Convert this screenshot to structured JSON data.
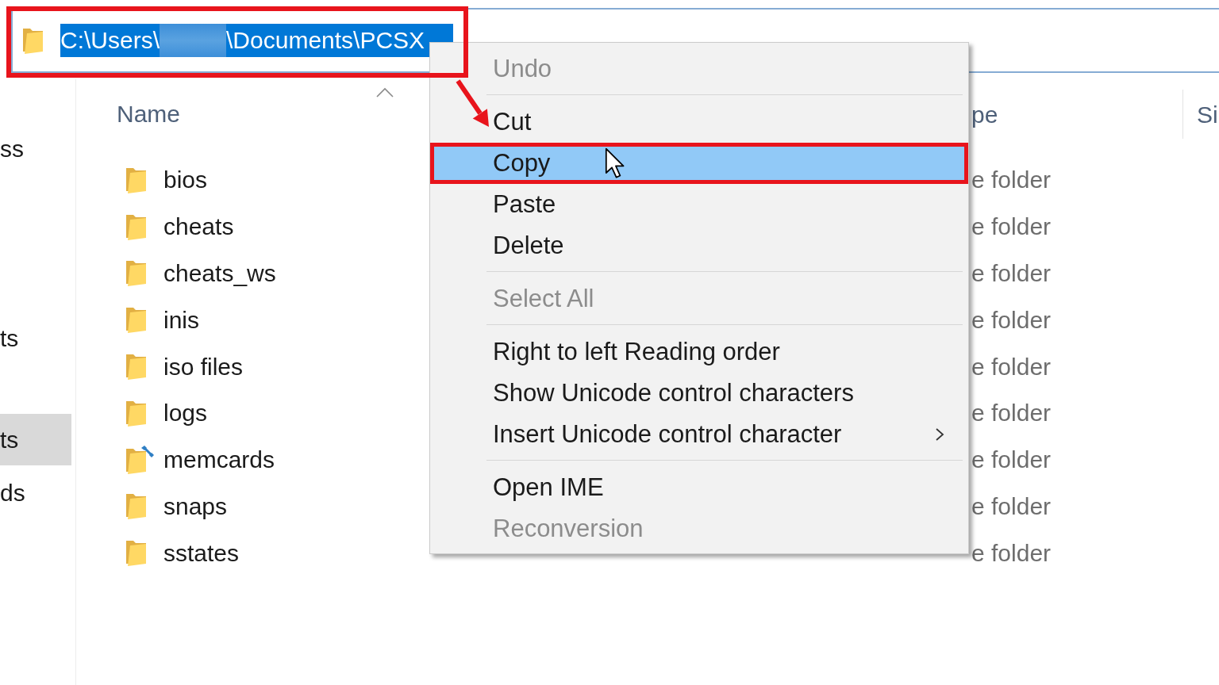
{
  "address_bar": {
    "selected": true,
    "segments": [
      {
        "kind": "text",
        "text": "C:\\Users\\"
      },
      {
        "kind": "redacted"
      },
      {
        "kind": "text",
        "text": "\\Documents\\PCSX"
      }
    ]
  },
  "navigation_pane": {
    "items": [
      {
        "label": "ss",
        "selected": false
      },
      {
        "label": "ts",
        "selected": false
      },
      {
        "label": "ts",
        "selected": true
      },
      {
        "label": "ds",
        "selected": false
      }
    ]
  },
  "file_list": {
    "columns": [
      {
        "label": "Name",
        "sorted": true
      },
      {
        "label": "pe",
        "sorted": false
      },
      {
        "label": "Si",
        "sorted": false
      }
    ],
    "rows": [
      {
        "name": "bios",
        "kind": "folder",
        "type": "e folder"
      },
      {
        "name": "cheats",
        "kind": "folder",
        "type": "e folder"
      },
      {
        "name": "cheats_ws",
        "kind": "folder",
        "type": "e folder"
      },
      {
        "name": "inis",
        "kind": "folder",
        "type": "e folder"
      },
      {
        "name": "iso files",
        "kind": "folder",
        "type": "e folder"
      },
      {
        "name": "logs",
        "kind": "folder",
        "type": "e folder"
      },
      {
        "name": "memcards",
        "kind": "badged_folder",
        "type": "e folder"
      },
      {
        "name": "snaps",
        "kind": "folder",
        "type": "e folder"
      },
      {
        "name": "sstates",
        "kind": "folder",
        "type": "e folder"
      }
    ]
  },
  "context_menu": {
    "groups": [
      [
        {
          "label": "Undo",
          "disabled": true,
          "selected": false,
          "submenu": false
        }
      ],
      [
        {
          "label": "Cut",
          "disabled": false,
          "selected": false,
          "submenu": false
        },
        {
          "label": "Copy",
          "disabled": false,
          "selected": true,
          "submenu": false
        },
        {
          "label": "Paste",
          "disabled": false,
          "selected": false,
          "submenu": false
        },
        {
          "label": "Delete",
          "disabled": false,
          "selected": false,
          "submenu": false
        }
      ],
      [
        {
          "label": "Select All",
          "disabled": true,
          "selected": false,
          "submenu": false
        }
      ],
      [
        {
          "label": "Right to left Reading order",
          "disabled": false,
          "selected": false,
          "submenu": false
        },
        {
          "label": "Show Unicode control characters",
          "disabled": false,
          "selected": false,
          "submenu": false
        },
        {
          "label": "Insert Unicode control character",
          "disabled": false,
          "selected": false,
          "submenu": true
        }
      ],
      [
        {
          "label": "Open IME",
          "disabled": false,
          "selected": false,
          "submenu": false
        },
        {
          "label": "Reconversion",
          "disabled": true,
          "selected": false,
          "submenu": false
        }
      ]
    ]
  }
}
